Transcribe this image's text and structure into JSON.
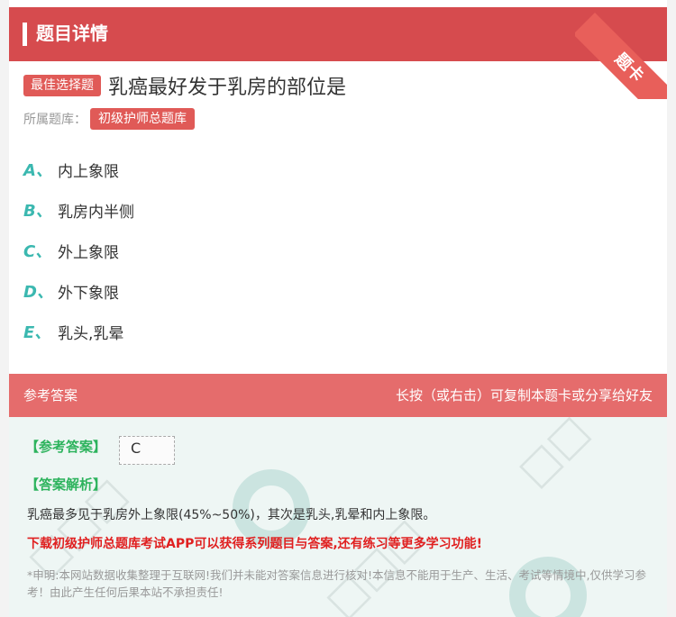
{
  "header": {
    "title": "题目详情",
    "corner_badge": "题卡"
  },
  "question": {
    "type_tag": "最佳选择题",
    "text": "乳癌最好发于乳房的部位是"
  },
  "bank": {
    "label": "所属题库：",
    "name": "初级护师总题库"
  },
  "options": [
    {
      "letter": "A、",
      "text": "内上象限"
    },
    {
      "letter": "B、",
      "text": "乳房内半侧"
    },
    {
      "letter": "C、",
      "text": "外上象限"
    },
    {
      "letter": "D、",
      "text": "外下象限"
    },
    {
      "letter": "E、",
      "text": "乳头,乳晕"
    }
  ],
  "answer_bar": {
    "left": "参考答案",
    "right": "长按（或右击）可复制本题卡或分享给好友"
  },
  "answer": {
    "label": "【参考答案】",
    "value": "C",
    "explanation_label": "【答案解析】",
    "explanation": "乳癌最多见于乳房外上象限(45%~50%)，其次是乳头,乳晕和内上象限。",
    "promo": "下载初级护师总题库考试APP可以获得系列题目与答案,还有练习等更多学习功能!",
    "disclaimer": "*申明:本网站数据收集整理于互联网!我们并未能对答案信息进行核对!本信息不能用于生产、生活、考试等情境中,仅供学习参考！由此产生任何后果本站不承担责任!"
  },
  "colors": {
    "header": "#d64b4e",
    "accent_red": "#e05a57",
    "option_letter": "#3bb8b0",
    "answer_green": "#2db35d",
    "answer_bg": "#eef6f4"
  }
}
